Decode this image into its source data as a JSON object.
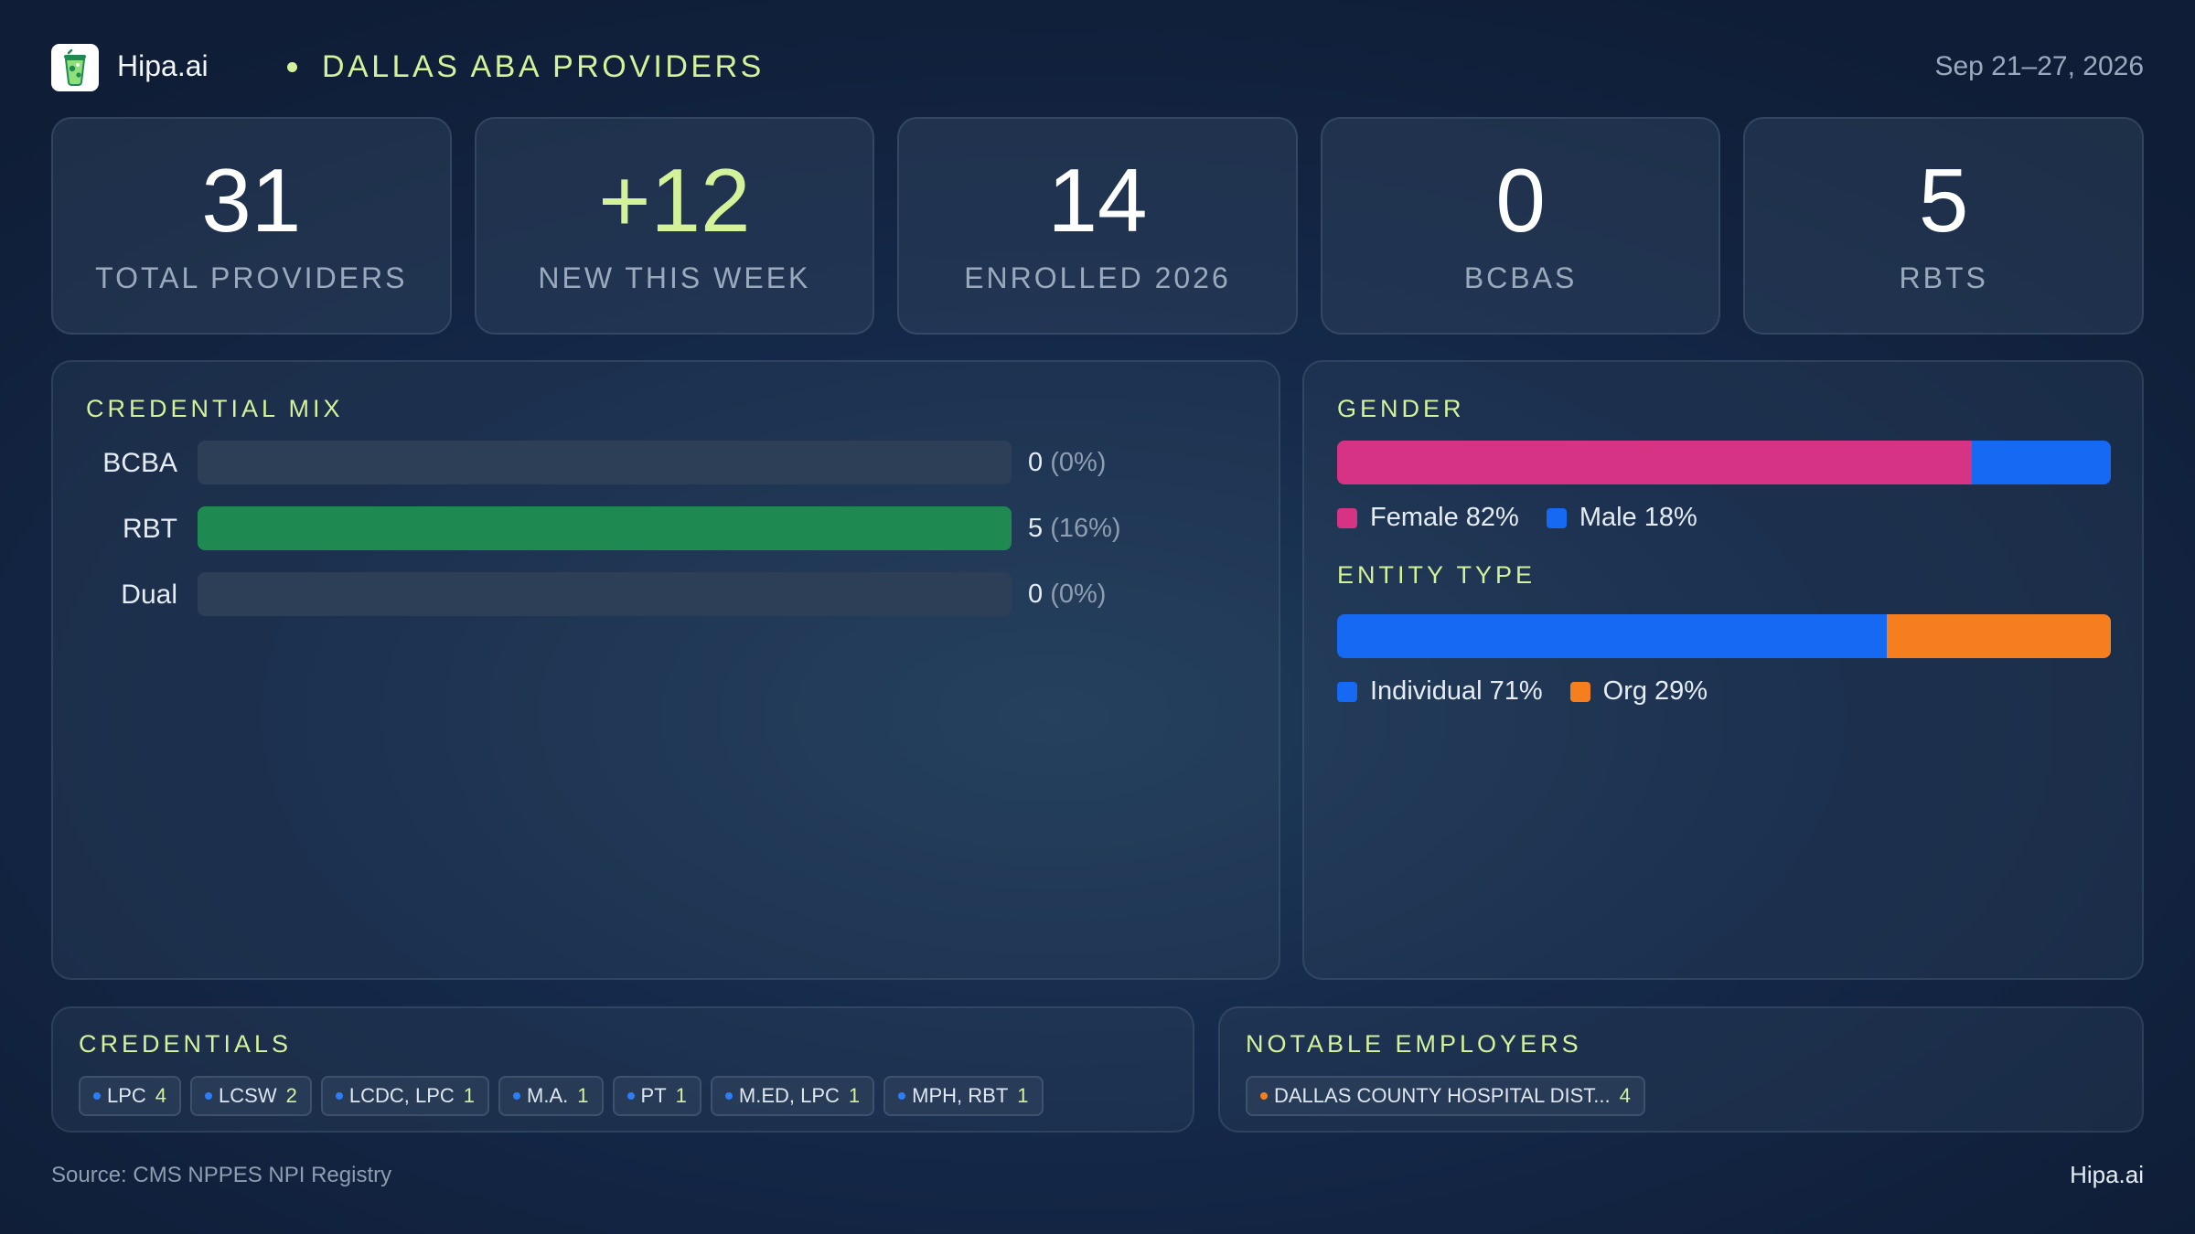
{
  "header": {
    "app_name": "Hipa.ai",
    "title": "DALLAS ABA PROVIDERS",
    "date_range": "Sep 21–27, 2026",
    "logo_icon": "cocktail-glass-icon"
  },
  "kpis": [
    {
      "value": "31",
      "label": "TOTAL PROVIDERS"
    },
    {
      "value": "+12",
      "label": "NEW THIS WEEK"
    },
    {
      "value": "14",
      "label": "ENROLLED 2026"
    },
    {
      "value": "0",
      "label": "BCBAS"
    },
    {
      "value": "5",
      "label": "RBTS"
    }
  ],
  "credential_mix": {
    "title": "CREDENTIAL MIX",
    "rows": [
      {
        "label": "BCBA",
        "count": "0",
        "pct": "(0%)",
        "fill": 0
      },
      {
        "label": "RBT",
        "count": "5",
        "pct": "(16%)",
        "fill": 1
      },
      {
        "label": "Dual",
        "count": "0",
        "pct": "(0%)",
        "fill": 0
      }
    ],
    "colors": {
      "fill": "#1e8a52",
      "track": "#2d3f56"
    }
  },
  "gender": {
    "title": "GENDER",
    "segments": [
      {
        "label": "Female 82%",
        "value": 82,
        "color": "#d63384"
      },
      {
        "label": "Male 18%",
        "value": 18,
        "color": "#1669f2"
      }
    ]
  },
  "entity_type": {
    "title": "ENTITY TYPE",
    "segments": [
      {
        "label": "Individual 71%",
        "value": 71,
        "color": "#1669f2"
      },
      {
        "label": "Org 29%",
        "value": 29,
        "color": "#f57f1f"
      }
    ]
  },
  "credentials": {
    "title": "CREDENTIALS",
    "chips": [
      {
        "label": "LPC",
        "count": "4"
      },
      {
        "label": "LCSW",
        "count": "2"
      },
      {
        "label": "LCDC, LPC",
        "count": "1"
      },
      {
        "label": "M.A.",
        "count": "1"
      },
      {
        "label": "PT",
        "count": "1"
      },
      {
        "label": "M.ED, LPC",
        "count": "1"
      },
      {
        "label": "MPH, RBT",
        "count": "1"
      }
    ]
  },
  "employers": {
    "title": "NOTABLE EMPLOYERS",
    "chips": [
      {
        "label": "DALLAS COUNTY HOSPITAL DIST...",
        "count": "4"
      }
    ]
  },
  "footer": {
    "source": "Source: CMS NPPES NPI Registry",
    "brand": "Hipa.ai"
  },
  "colors": {
    "accent": "#d4f29a",
    "muted_text": "#9aa9bb"
  }
}
